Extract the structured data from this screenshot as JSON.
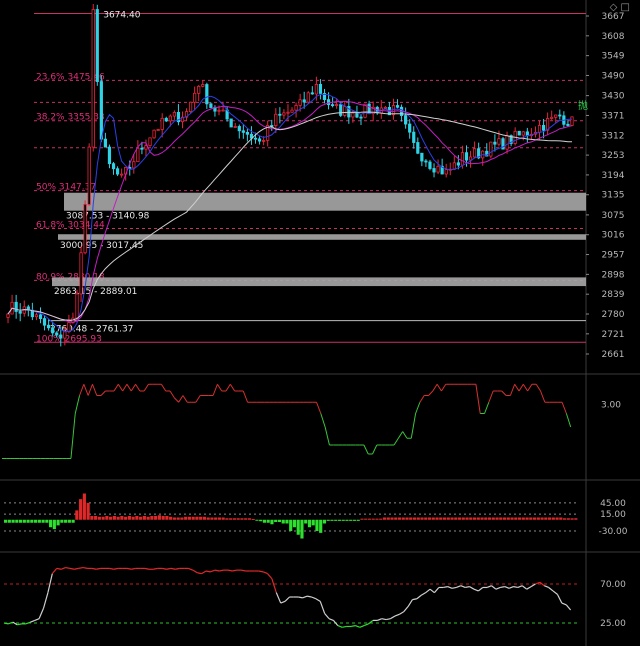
{
  "header": {
    "icon_left": "◇",
    "icon_right": "□"
  },
  "chart_data": [
    {
      "type": "line",
      "panel": "price",
      "y_ticks": [
        "3667",
        "3608",
        "3549",
        "3490",
        "3430",
        "3371",
        "3312",
        "3253",
        "3194",
        "3135",
        "3075",
        "3016",
        "2957",
        "2898",
        "2839",
        "2780",
        "2721",
        "2661"
      ],
      "ylim": [
        2640,
        3690
      ],
      "peak_label": "3674.40",
      "fib_levels": [
        {
          "label": "23.6% 3475.46",
          "value": 3475.46
        },
        {
          "label": "38.2% 3355.33",
          "value": 3355.33
        },
        {
          "label": "50% 3147.37",
          "value": 3147.37
        },
        {
          "label": "61.8% 3034.44",
          "value": 3034.44
        },
        {
          "label": "80.9% 2880.18",
          "value": 2880.18
        },
        {
          "label": "100% 2695.93",
          "value": 2695.93
        }
      ],
      "top_line": 3674.4,
      "dashed_levels": [
        3410,
        3275
      ],
      "zones": [
        {
          "label": "3087.53 - 3140.98",
          "low": 3087.53,
          "high": 3140.98
        },
        {
          "label": "3000.95 - 3017.45",
          "low": 3000.95,
          "high": 3017.45
        },
        {
          "label": "2863.15 - 2889.01",
          "low": 2863.15,
          "high": 2889.01
        }
      ],
      "support_level": {
        "label": "2760.48 - 2761.37",
        "value": 2760.5
      },
      "mark": "抛",
      "up_color": "#e8253a",
      "down_color": "#2fd3e6",
      "ma_colors": {
        "ma_short": "#2a40e8",
        "ma_mid": "#c21fc2",
        "ma_long": "#cfcfcf"
      }
    },
    {
      "type": "line",
      "panel": "indicator-1",
      "y_ticks": [
        "3.00"
      ],
      "ylim": [
        0,
        4
      ],
      "series": [
        {
          "values": [
            0.6,
            0.6,
            0.6,
            0.6,
            0.6,
            0.6,
            0.6,
            0.6,
            0.6,
            0.6,
            0.6,
            0.6,
            0.6,
            0.6,
            0.6,
            0.6,
            0.6,
            2.6,
            3.4,
            3.9,
            3.4,
            3.9,
            3.4,
            3.4,
            3.6,
            3.6,
            3.6,
            3.9,
            3.6,
            3.9,
            3.6,
            3.9,
            3.6,
            3.6,
            3.9,
            3.9,
            3.9,
            3.9,
            3.6,
            3.6,
            3.3,
            3.1,
            3.4,
            3.1,
            3.1,
            3.1,
            3.4,
            3.4,
            3.4,
            3.4,
            3.9,
            3.6,
            3.6,
            3.9,
            3.6,
            3.6,
            3.6,
            3.1,
            3.1,
            3.1,
            3.1,
            3.1,
            3.1,
            3.1,
            3.1,
            3.1,
            3.1,
            3.1,
            3.1,
            3.1,
            3.1,
            3.1,
            3.1,
            3.1,
            2.6,
            2.0,
            1.2,
            1.2,
            1.2,
            1.2,
            1.2,
            1.2,
            1.2,
            1.2,
            1.2,
            0.8,
            0.8,
            1.2,
            1.2,
            1.2,
            1.2,
            1.2,
            1.5,
            1.8,
            1.5,
            1.5,
            2.6,
            3.1,
            3.4,
            3.4,
            3.6,
            3.9,
            3.6,
            3.9,
            3.9,
            3.9,
            3.9,
            3.9,
            3.9,
            3.9,
            3.9,
            2.6,
            2.6,
            3.1,
            3.6,
            3.6,
            3.6,
            3.4,
            3.4,
            3.9,
            3.6,
            3.9,
            3.6,
            3.9,
            3.9,
            3.6,
            3.1,
            3.1,
            3.1,
            3.1,
            3.1,
            2.6,
            2.0
          ]
        }
      ]
    },
    {
      "type": "bar",
      "panel": "indicator-2",
      "y_ticks": [
        "45.00",
        "15.00",
        "-30.00"
      ],
      "ylim": [
        -70,
        90
      ],
      "values": [
        -8,
        -8,
        -8,
        -8,
        -8,
        -8,
        -8,
        -8,
        -8,
        -8,
        -8,
        -8,
        -20,
        -25,
        -15,
        -8,
        -8,
        -8,
        -8,
        25,
        55,
        70,
        45,
        10,
        10,
        8,
        8,
        10,
        8,
        10,
        8,
        10,
        8,
        10,
        8,
        10,
        8,
        10,
        8,
        10,
        10,
        12,
        10,
        10,
        8,
        6,
        6,
        6,
        8,
        8,
        8,
        8,
        8,
        8,
        6,
        6,
        6,
        6,
        6,
        4,
        4,
        4,
        4,
        4,
        4,
        4,
        2,
        -2,
        -4,
        -8,
        -8,
        -12,
        -6,
        -6,
        -10,
        -10,
        -30,
        -20,
        -40,
        -50,
        -10,
        -20,
        -15,
        -30,
        -35,
        -10,
        -3,
        -3,
        -3,
        -3,
        -3,
        -3,
        -3,
        -3,
        -3,
        3,
        3,
        3,
        3,
        3,
        3,
        6,
        6,
        6,
        6,
        6,
        6,
        6,
        6,
        6,
        6,
        6,
        6,
        6,
        6,
        6,
        6,
        6,
        6,
        6,
        6,
        6,
        6,
        6,
        6,
        6,
        6,
        6,
        6,
        6,
        6,
        6,
        6,
        6,
        6,
        6,
        6,
        6,
        6,
        6,
        6,
        6,
        6,
        6,
        6,
        6,
        6,
        6,
        6,
        4,
        4,
        4,
        4
      ],
      "levels": [
        45,
        15,
        -30
      ]
    },
    {
      "type": "line",
      "panel": "indicator-3",
      "y_ticks": [
        "70.00",
        "25.00"
      ],
      "ylim": [
        10,
        100
      ],
      "series": [
        {
          "values": [
            25,
            24,
            26,
            23,
            24,
            24,
            26,
            28,
            30,
            42,
            60,
            82,
            88,
            87,
            89,
            88,
            87,
            88,
            89,
            88,
            88,
            87,
            88,
            88,
            88,
            87,
            88,
            88,
            88,
            87,
            88,
            88,
            88,
            87,
            87,
            88,
            88,
            87,
            88,
            87,
            88,
            88,
            88,
            86,
            83,
            82,
            85,
            84,
            86,
            85,
            86,
            86,
            85,
            86,
            86,
            85,
            85,
            85,
            85,
            84,
            82,
            76,
            60,
            48,
            50,
            55,
            55,
            55,
            54,
            56,
            55,
            53,
            50,
            36,
            30,
            28,
            22,
            20,
            21,
            21,
            22,
            20,
            22,
            24,
            28,
            28,
            30,
            29,
            30,
            33,
            35,
            38,
            44,
            52,
            53,
            57,
            60,
            64,
            60,
            66,
            66,
            67,
            65,
            66,
            68,
            66,
            67,
            64,
            62,
            66,
            66,
            68,
            64,
            66,
            67,
            65,
            67,
            66,
            68,
            64,
            67,
            70,
            72,
            68,
            66,
            62,
            58,
            48,
            46,
            40
          ]
        }
      ],
      "levels": [
        70,
        25
      ]
    }
  ]
}
